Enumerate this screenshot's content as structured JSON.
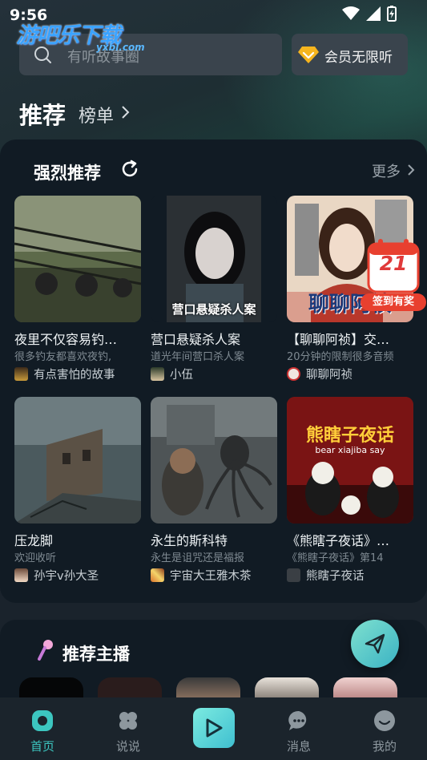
{
  "status_bar": {
    "time": "9:56"
  },
  "watermark": {
    "title": "游吧乐下载",
    "sub": "yxbl.com"
  },
  "search": {
    "placeholder": "有听故事圈"
  },
  "vip": {
    "label": "会员无限听"
  },
  "tabs": {
    "recommend": "推荐",
    "rank": "榜单"
  },
  "featured": {
    "title": "强烈推荐",
    "more": "更多",
    "items": [
      {
        "title": "夜里不仅容易钓…",
        "subtitle": "很多钓友都喜欢夜钓,",
        "author": "有点害怕的故事",
        "cover_icon": "fishing-rods-image"
      },
      {
        "title": "营口悬疑杀人案",
        "subtitle": "道光年间营口杀人案",
        "author": "小伍",
        "cover_caption": "营口悬疑杀人案",
        "cover_icon": "woman-portrait-image"
      },
      {
        "title": "【聊聊阿祯】交…",
        "subtitle": "20分钟的限制很多音频",
        "author": "聊聊阿祯",
        "cover_caption": "聊聊阿祯",
        "cover_icon": "manga-girl-image"
      },
      {
        "title": "压龙脚",
        "subtitle": "欢迎收听",
        "author": "孙宇v孙大圣",
        "cover_icon": "abandoned-village-image"
      },
      {
        "title": "永生的斯科特",
        "subtitle": "永生是诅咒还是福报",
        "author": "宇宙大王雅木茶",
        "cover_icon": "tentacle-monster-image"
      },
      {
        "title": "《熊瞎子夜话》…",
        "subtitle": "《熊瞎子夜话》第14",
        "author": "熊瞎子夜话",
        "cover_title": "熊瞎子夜话",
        "cover_subtitle": "bear xiajiba say",
        "cover_icon": "bear-cartoon-image"
      }
    ]
  },
  "signin": {
    "day": "21",
    "label": "签到有奖"
  },
  "hosts": {
    "title": "推荐主播"
  },
  "nav": {
    "items": [
      {
        "label": "首页",
        "icon": "home-icon",
        "active": true
      },
      {
        "label": "说说",
        "icon": "posts-icon"
      },
      {
        "label": "消息",
        "icon": "message-icon"
      },
      {
        "label": "我的",
        "icon": "profile-icon"
      }
    ],
    "play_icon": "play-icon"
  },
  "colors": {
    "accent": "#3cc6c0",
    "background": "#1a232c",
    "card": "#111b24",
    "signin_red": "#e8402f"
  }
}
